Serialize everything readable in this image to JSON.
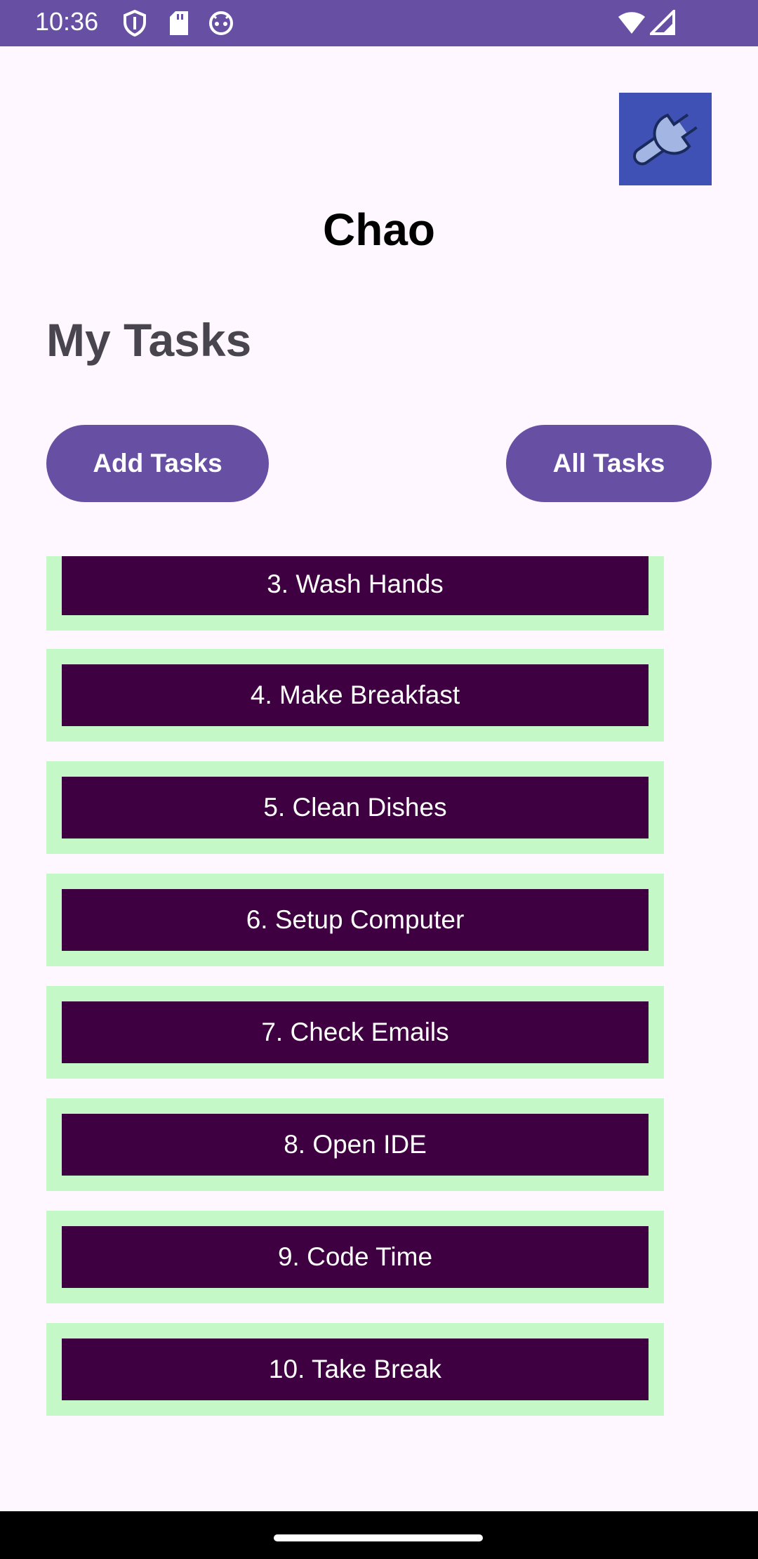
{
  "status_bar": {
    "time": "10:36",
    "left_icons": [
      "shield-icon",
      "sd-card-icon",
      "android-face-icon"
    ],
    "right_icons": [
      "wifi-icon",
      "signal-icon"
    ],
    "background": "#6750A4"
  },
  "header": {
    "settings_icon": "wrench-icon",
    "user_name": "Chao"
  },
  "main": {
    "section_title": "My Tasks",
    "add_button_label": "Add Tasks",
    "all_button_label": "All Tasks",
    "tasks": [
      {
        "label": "3. Wash Hands"
      },
      {
        "label": "4. Make Breakfast"
      },
      {
        "label": "5. Clean Dishes"
      },
      {
        "label": "6. Setup Computer"
      },
      {
        "label": "7. Check Emails"
      },
      {
        "label": "8. Open IDE"
      },
      {
        "label": "9. Code Time"
      },
      {
        "label": "10. Take Break"
      }
    ]
  },
  "colors": {
    "primary": "#6750A4",
    "task_border": "#C4F8C7",
    "task_fill": "#3F0041",
    "settings_bg": "#3F51B5",
    "background": "#FEF7FF"
  }
}
